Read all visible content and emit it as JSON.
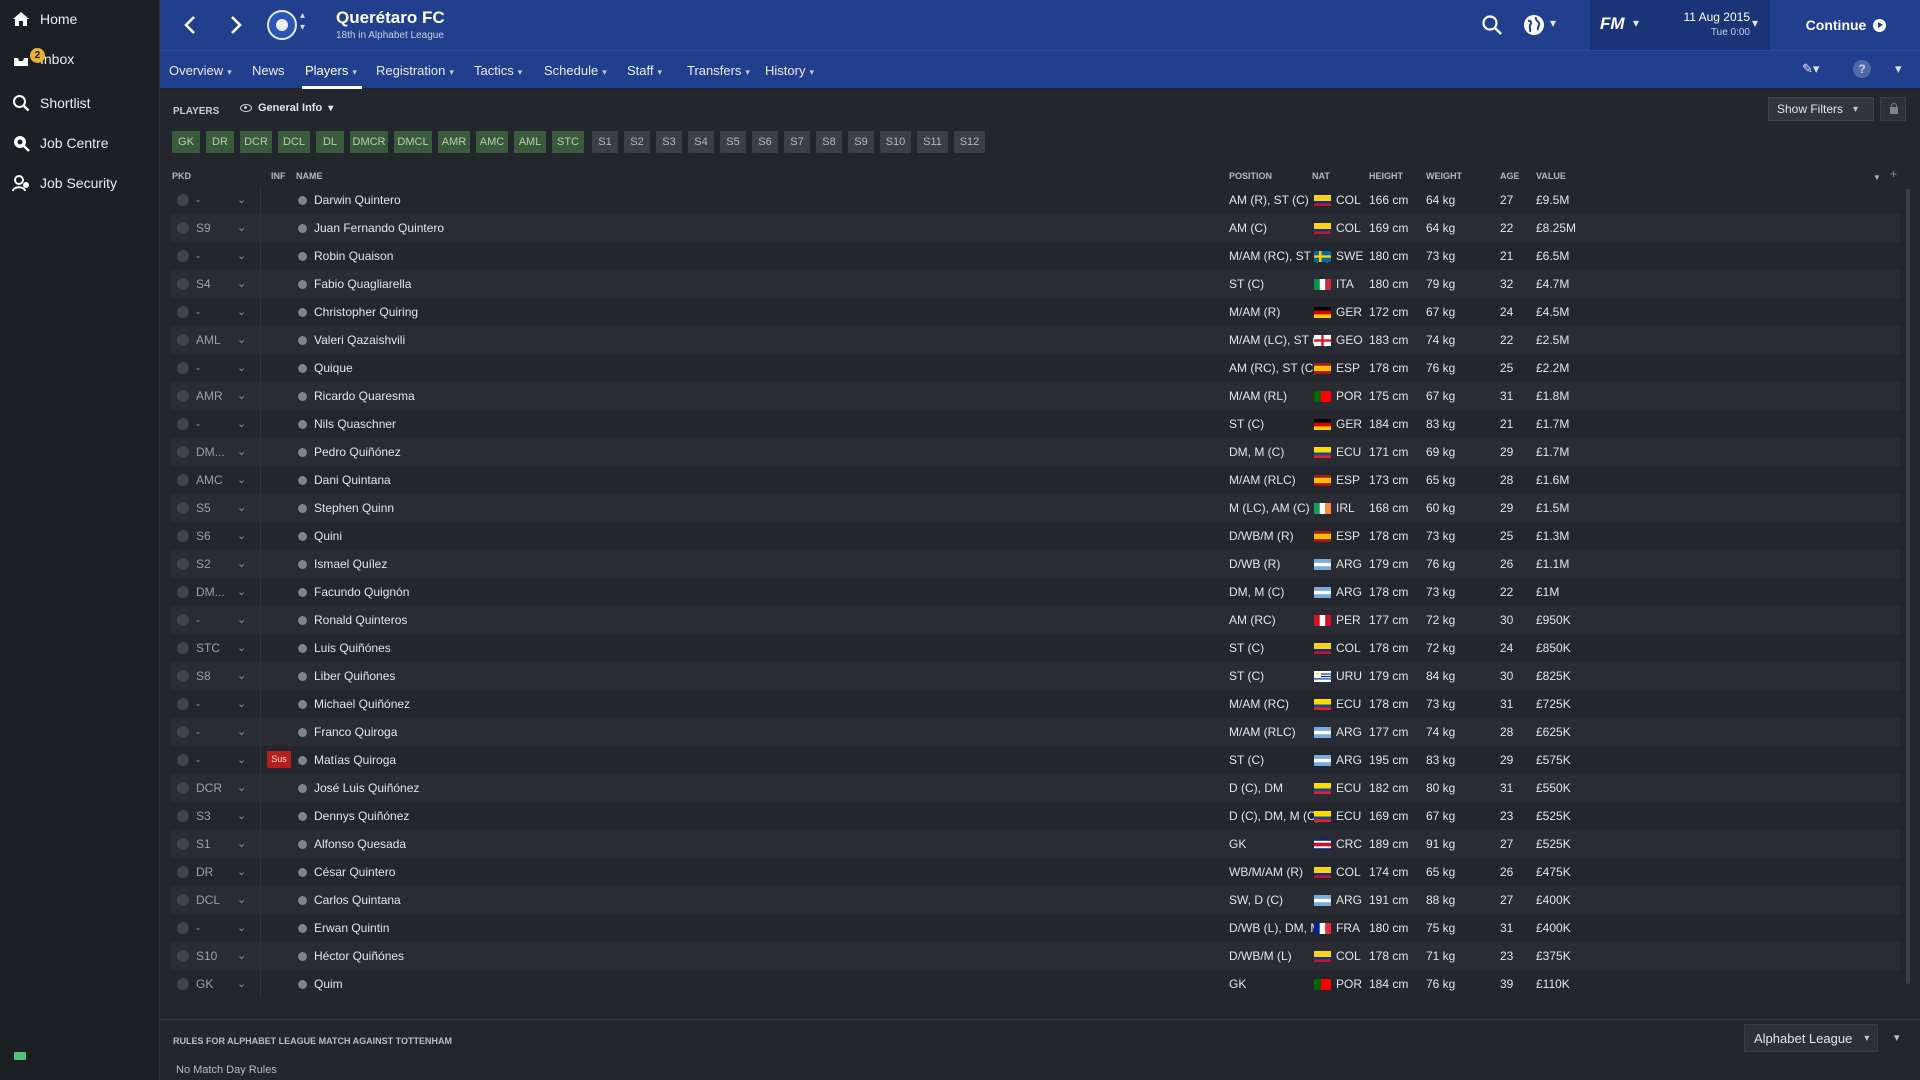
{
  "sidebar": {
    "items": [
      {
        "label": "Home",
        "icon": "home-icon"
      },
      {
        "label": "Inbox",
        "icon": "inbox-icon",
        "badge": "2"
      },
      {
        "label": "Shortlist",
        "icon": "search-icon"
      },
      {
        "label": "Job Centre",
        "icon": "job-centre-icon"
      },
      {
        "label": "Job Security",
        "icon": "job-security-icon"
      }
    ]
  },
  "header": {
    "club_name": "Querétaro FC",
    "club_subtitle": "18th in Alphabet League",
    "fm_logo": "FM",
    "date": "11 Aug 2015",
    "day_time": "Tue 0:00",
    "continue_label": "Continue"
  },
  "menu": {
    "items": [
      "Overview",
      "News",
      "Players",
      "Registration",
      "Tactics",
      "Schedule",
      "Staff",
      "Transfers",
      "History"
    ],
    "active": "Players"
  },
  "toolbar": {
    "players_label": "PLAYERS",
    "view_label": "General Info",
    "show_filters": "Show Filters"
  },
  "position_chips": {
    "green": [
      "GK",
      "DR",
      "DCR",
      "DCL",
      "DL",
      "DMCR",
      "DMCL",
      "AMR",
      "AMC",
      "AML",
      "STC"
    ],
    "gray": [
      "S1",
      "S2",
      "S3",
      "S4",
      "S5",
      "S6",
      "S7",
      "S8",
      "S9",
      "S10",
      "S11",
      "S12"
    ]
  },
  "columns": {
    "pkd": "PKD",
    "inf": "INF",
    "name": "NAME",
    "position": "POSITION",
    "nat": "NAT",
    "height": "HEIGHT",
    "weight": "WEIGHT",
    "age": "AGE",
    "value": "VALUE"
  },
  "players": [
    {
      "pkd": "-",
      "inf": "",
      "name": "Darwin Quintero",
      "position": "AM (R), ST (C)",
      "nat": "COL",
      "height": "166 cm",
      "weight": "64 kg",
      "age": "27",
      "value": "£9.5M"
    },
    {
      "pkd": "S9",
      "inf": "",
      "name": "Juan Fernando Quintero",
      "position": "AM (C)",
      "nat": "COL",
      "height": "169 cm",
      "weight": "64 kg",
      "age": "22",
      "value": "£8.25M"
    },
    {
      "pkd": "-",
      "inf": "",
      "name": "Robin Quaison",
      "position": "M/AM (RC), ST (C)",
      "nat": "SWE",
      "height": "180 cm",
      "weight": "73 kg",
      "age": "21",
      "value": "£6.5M"
    },
    {
      "pkd": "S4",
      "inf": "",
      "name": "Fabio Quagliarella",
      "position": "ST (C)",
      "nat": "ITA",
      "height": "180 cm",
      "weight": "79 kg",
      "age": "32",
      "value": "£4.7M"
    },
    {
      "pkd": "-",
      "inf": "",
      "name": "Christopher Quiring",
      "position": "M/AM (R)",
      "nat": "GER",
      "height": "172 cm",
      "weight": "67 kg",
      "age": "24",
      "value": "£4.5M"
    },
    {
      "pkd": "AML",
      "inf": "",
      "name": "Valeri Qazaishvili",
      "position": "M/AM (LC), ST (C)",
      "nat": "GEO",
      "height": "183 cm",
      "weight": "74 kg",
      "age": "22",
      "value": "£2.5M"
    },
    {
      "pkd": "-",
      "inf": "",
      "name": "Quique",
      "position": "AM (RC), ST (C)",
      "nat": "ESP",
      "height": "178 cm",
      "weight": "76 kg",
      "age": "25",
      "value": "£2.2M"
    },
    {
      "pkd": "AMR",
      "inf": "",
      "name": "Ricardo Quaresma",
      "position": "M/AM (RL)",
      "nat": "POR",
      "height": "175 cm",
      "weight": "67 kg",
      "age": "31",
      "value": "£1.8M"
    },
    {
      "pkd": "-",
      "inf": "",
      "name": "Nils Quaschner",
      "position": "ST (C)",
      "nat": "GER",
      "height": "184 cm",
      "weight": "83 kg",
      "age": "21",
      "value": "£1.7M"
    },
    {
      "pkd": "DM...",
      "inf": "",
      "name": "Pedro Quiñónez",
      "position": "DM, M (C)",
      "nat": "ECU",
      "height": "171 cm",
      "weight": "69 kg",
      "age": "29",
      "value": "£1.7M"
    },
    {
      "pkd": "AMC",
      "inf": "",
      "name": "Dani Quintana",
      "position": "M/AM (RLC)",
      "nat": "ESP",
      "height": "173 cm",
      "weight": "65 kg",
      "age": "28",
      "value": "£1.6M"
    },
    {
      "pkd": "S5",
      "inf": "",
      "name": "Stephen Quinn",
      "position": "M (LC), AM (C)",
      "nat": "IRL",
      "height": "168 cm",
      "weight": "60 kg",
      "age": "29",
      "value": "£1.5M"
    },
    {
      "pkd": "S6",
      "inf": "",
      "name": "Quini",
      "position": "D/WB/M (R)",
      "nat": "ESP",
      "height": "178 cm",
      "weight": "73 kg",
      "age": "25",
      "value": "£1.3M"
    },
    {
      "pkd": "S2",
      "inf": "",
      "name": "Ismael Quílez",
      "position": "D/WB (R)",
      "nat": "ARG",
      "height": "179 cm",
      "weight": "76 kg",
      "age": "26",
      "value": "£1.1M"
    },
    {
      "pkd": "DM...",
      "inf": "",
      "name": "Facundo Quignón",
      "position": "DM, M (C)",
      "nat": "ARG",
      "height": "178 cm",
      "weight": "73 kg",
      "age": "22",
      "value": "£1M"
    },
    {
      "pkd": "-",
      "inf": "",
      "name": "Ronald Quinteros",
      "position": "AM (RC)",
      "nat": "PER",
      "height": "177 cm",
      "weight": "72 kg",
      "age": "30",
      "value": "£950K"
    },
    {
      "pkd": "STC",
      "inf": "",
      "name": "Luis Quiñónes",
      "position": "ST (C)",
      "nat": "COL",
      "height": "178 cm",
      "weight": "72 kg",
      "age": "24",
      "value": "£850K"
    },
    {
      "pkd": "S8",
      "inf": "",
      "name": "Liber Quiñones",
      "position": "ST (C)",
      "nat": "URU",
      "height": "179 cm",
      "weight": "84 kg",
      "age": "30",
      "value": "£825K"
    },
    {
      "pkd": "-",
      "inf": "",
      "name": "Michael Quiñónez",
      "position": "M/AM (RC)",
      "nat": "ECU",
      "height": "178 cm",
      "weight": "73 kg",
      "age": "31",
      "value": "£725K"
    },
    {
      "pkd": "-",
      "inf": "",
      "name": "Franco Quiroga",
      "position": "M/AM (RLC)",
      "nat": "ARG",
      "height": "177 cm",
      "weight": "74 kg",
      "age": "28",
      "value": "£625K"
    },
    {
      "pkd": "-",
      "inf": "Sus",
      "name": "Matías Quiroga",
      "position": "ST (C)",
      "nat": "ARG",
      "height": "195 cm",
      "weight": "83 kg",
      "age": "29",
      "value": "£575K"
    },
    {
      "pkd": "DCR",
      "inf": "",
      "name": "José Luis Quiñónez",
      "position": "D (C), DM",
      "nat": "ECU",
      "height": "182 cm",
      "weight": "80 kg",
      "age": "31",
      "value": "£550K"
    },
    {
      "pkd": "S3",
      "inf": "",
      "name": "Dennys Quiñónez",
      "position": "D (C), DM, M (C)",
      "nat": "ECU",
      "height": "169 cm",
      "weight": "67 kg",
      "age": "23",
      "value": "£525K"
    },
    {
      "pkd": "S1",
      "inf": "",
      "name": "Alfonso Quesada",
      "position": "GK",
      "nat": "CRC",
      "height": "189 cm",
      "weight": "91 kg",
      "age": "27",
      "value": "£525K"
    },
    {
      "pkd": "DR",
      "inf": "",
      "name": "César Quintero",
      "position": "WB/M/AM (R)",
      "nat": "COL",
      "height": "174 cm",
      "weight": "65 kg",
      "age": "26",
      "value": "£475K"
    },
    {
      "pkd": "DCL",
      "inf": "",
      "name": "Carlos Quintana",
      "position": "SW, D (C)",
      "nat": "ARG",
      "height": "191 cm",
      "weight": "88 kg",
      "age": "27",
      "value": "£400K"
    },
    {
      "pkd": "-",
      "inf": "",
      "name": "Erwan Quintin",
      "position": "D/WB (L), DM, M...",
      "nat": "FRA",
      "height": "180 cm",
      "weight": "75 kg",
      "age": "31",
      "value": "£400K"
    },
    {
      "pkd": "S10",
      "inf": "",
      "name": "Héctor Quiñónes",
      "position": "D/WB/M (L)",
      "nat": "COL",
      "height": "178 cm",
      "weight": "71 kg",
      "age": "23",
      "value": "£375K"
    },
    {
      "pkd": "GK",
      "inf": "",
      "name": "Quim",
      "position": "GK",
      "nat": "POR",
      "height": "184 cm",
      "weight": "76 kg",
      "age": "39",
      "value": "£110K"
    }
  ],
  "rules": {
    "title": "RULES FOR ALPHABET LEAGUE MATCH AGAINST TOTTENHAM",
    "text": "No Match Day Rules",
    "league_select": "Alphabet League"
  },
  "colors": {
    "header_bg": "#213f8c",
    "sidebar_bg": "#1c1f24",
    "content_bg": "#23272d",
    "chip_green": "#3a5b3b",
    "suspended_red": "#b3201e"
  }
}
